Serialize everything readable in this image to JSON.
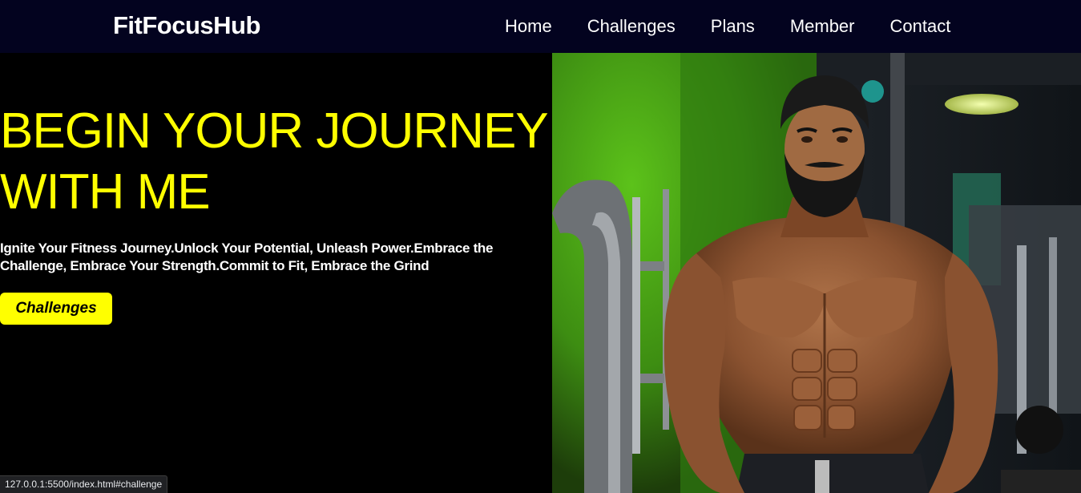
{
  "header": {
    "logo": "FitFocusHub",
    "nav": [
      {
        "label": "Home"
      },
      {
        "label": "Challenges"
      },
      {
        "label": "Plans"
      },
      {
        "label": "Member"
      },
      {
        "label": "Contact"
      }
    ]
  },
  "hero": {
    "title_line1": "BEGIN YOUR JOURNEY",
    "title_line2": "WITH ME",
    "subtitle": "Ignite Your Fitness Journey.Unlock Your Potential, Unleash Power.Embrace the Challenge, Embrace Your Strength.Commit to Fit, Embrace the Grind",
    "cta_label": "Challenges",
    "image_subject": "bodybuilder-in-gym"
  },
  "status_bar": {
    "url": "127.0.0.1:5500/index.html#challenge"
  },
  "colors": {
    "navbar_bg": "#03031f",
    "accent_yellow": "#ffff00",
    "page_bg": "#000000"
  }
}
